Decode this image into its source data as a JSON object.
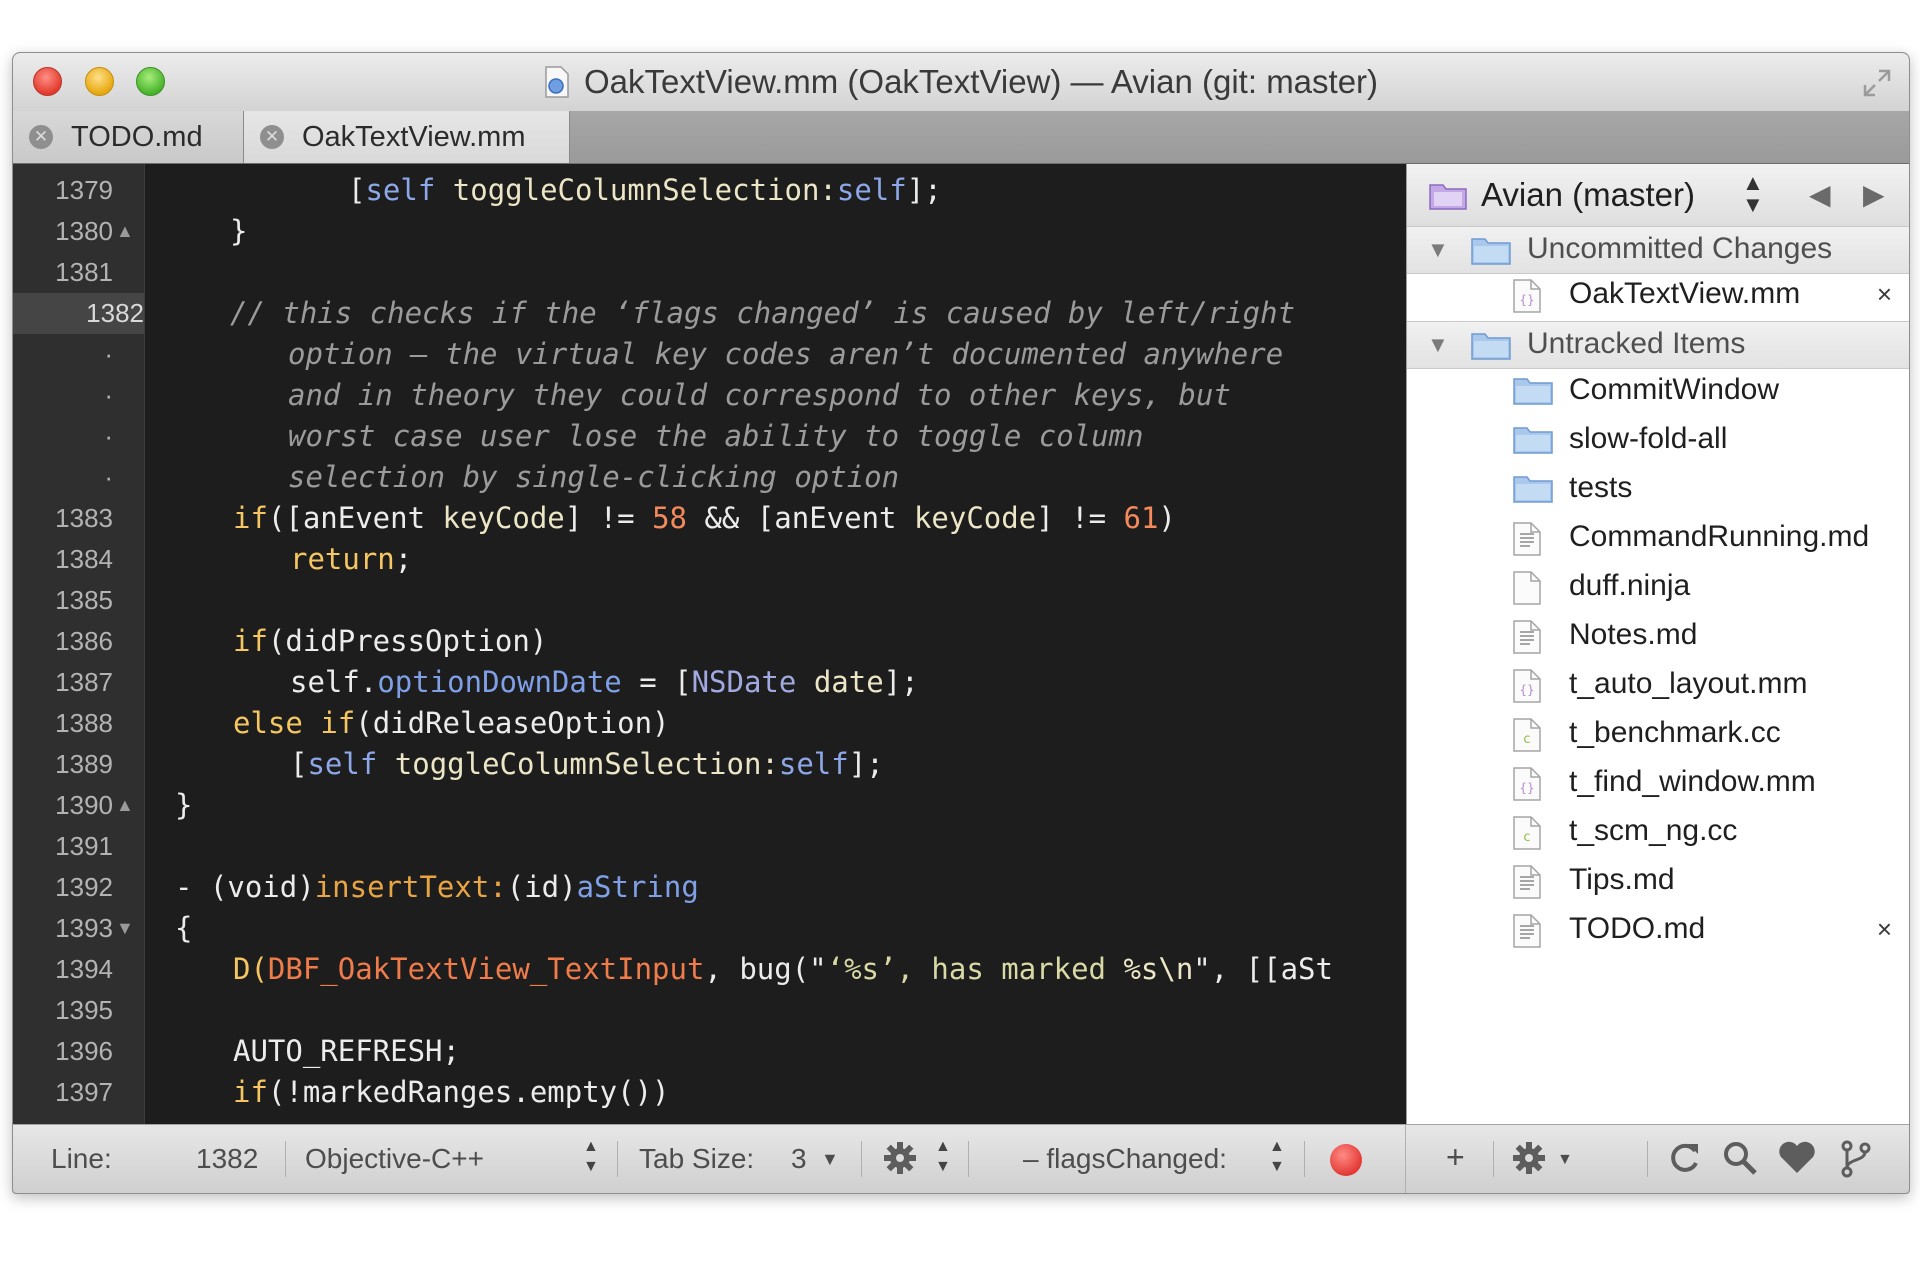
{
  "window": {
    "title": "OakTextView.mm (OakTextView) — Avian (git: master)"
  },
  "tabs": [
    {
      "label": "TODO.md",
      "active": false
    },
    {
      "label": "OakTextView.mm",
      "active": true
    }
  ],
  "gutter": {
    "lines": [
      {
        "n": "1379",
        "fold": ""
      },
      {
        "n": "1380",
        "fold": "▲"
      },
      {
        "n": "1381",
        "fold": ""
      },
      {
        "n": "1382",
        "fold": "",
        "current": true
      },
      {
        "n": "·",
        "fold": ""
      },
      {
        "n": "·",
        "fold": ""
      },
      {
        "n": "·",
        "fold": ""
      },
      {
        "n": "·",
        "fold": ""
      },
      {
        "n": "1383",
        "fold": ""
      },
      {
        "n": "1384",
        "fold": ""
      },
      {
        "n": "1385",
        "fold": ""
      },
      {
        "n": "1386",
        "fold": ""
      },
      {
        "n": "1387",
        "fold": ""
      },
      {
        "n": "1388",
        "fold": ""
      },
      {
        "n": "1389",
        "fold": ""
      },
      {
        "n": "1390",
        "fold": "▲"
      },
      {
        "n": "1391",
        "fold": ""
      },
      {
        "n": "1392",
        "fold": ""
      },
      {
        "n": "1393",
        "fold": "▼"
      },
      {
        "n": "1394",
        "fold": ""
      },
      {
        "n": "1395",
        "fold": ""
      },
      {
        "n": "1396",
        "fold": ""
      },
      {
        "n": "1397",
        "fold": ""
      }
    ]
  },
  "code": {
    "l0": [
      "[",
      "self",
      " ",
      "toggleColumnSelection:",
      "self",
      "];"
    ],
    "l1": [
      "}"
    ],
    "l3": [
      "// this checks if the ‘flags changed’ is caused by left/right"
    ],
    "l4": [
      "option — the virtual key codes aren’t documented anywhere"
    ],
    "l5": [
      "and in theory they could correspond to other keys, but"
    ],
    "l6": [
      "worst case user lose the ability to toggle column"
    ],
    "l7": [
      "selection by single-clicking option"
    ],
    "l8": [
      "if",
      "([anEvent ",
      "keyCode",
      "] != ",
      "58",
      " && [anEvent ",
      "keyCode",
      "] != ",
      "61",
      ")"
    ],
    "l9": [
      "return",
      ";"
    ],
    "l11": [
      "if",
      "(didPressOption)"
    ],
    "l12": [
      "self.",
      "optionDownDate",
      " = [",
      "NSDate",
      " ",
      "date",
      "];"
    ],
    "l13": [
      "else",
      " ",
      "if",
      "(didReleaseOption)"
    ],
    "l14": [
      "[",
      "self",
      " ",
      "toggleColumnSelection:",
      "self",
      "];"
    ],
    "l15": [
      "}"
    ],
    "l17": [
      "- (void)",
      "insertText:",
      "(id)",
      "aString"
    ],
    "l18": [
      "{"
    ],
    "l19": [
      "D(",
      "DBF_OakTextView_TextInput",
      ", bug(\"",
      "‘%s’, has marked ",
      "%s\\n",
      "\", [[aSt"
    ],
    "l21": [
      "AUTO_REFRESH;"
    ],
    "l22": [
      "if",
      "(!markedRanges.empty())"
    ]
  },
  "sidebar": {
    "project_label": "Avian (master)",
    "groups": [
      {
        "label": "Uncommitted Changes"
      },
      {
        "label": "Untracked Items"
      }
    ],
    "uncommitted": [
      {
        "label": "OakTextView.mm",
        "icon": "objc-file-icon",
        "close": "×"
      }
    ],
    "untracked": [
      {
        "label": "CommitWindow",
        "icon": "folder-icon"
      },
      {
        "label": "slow-fold-all",
        "icon": "folder-icon"
      },
      {
        "label": "tests",
        "icon": "folder-icon"
      },
      {
        "label": "CommandRunning.md",
        "icon": "text-file-icon"
      },
      {
        "label": "duff.ninja",
        "icon": "blank-file-icon"
      },
      {
        "label": "Notes.md",
        "icon": "text-file-icon"
      },
      {
        "label": "t_auto_layout.mm",
        "icon": "objc-file-icon"
      },
      {
        "label": "t_benchmark.cc",
        "icon": "c-file-icon"
      },
      {
        "label": "t_find_window.mm",
        "icon": "objc-file-icon"
      },
      {
        "label": "t_scm_ng.cc",
        "icon": "c-file-icon"
      },
      {
        "label": "Tips.md",
        "icon": "text-file-icon"
      },
      {
        "label": "TODO.md",
        "icon": "text-file-icon",
        "close": "×"
      }
    ]
  },
  "status": {
    "line_label": "Line:",
    "line_value": "1382",
    "language": "Objective-C++",
    "tab_size_label": "Tab Size:",
    "tab_size_value": "3",
    "symbol": "– flagsChanged:"
  },
  "colors": {
    "editor_bg": "#1d1d1d",
    "keyword": "#f5c661",
    "comment": "#9b9b9b",
    "number": "#f4895b",
    "record": "#e33a35"
  }
}
